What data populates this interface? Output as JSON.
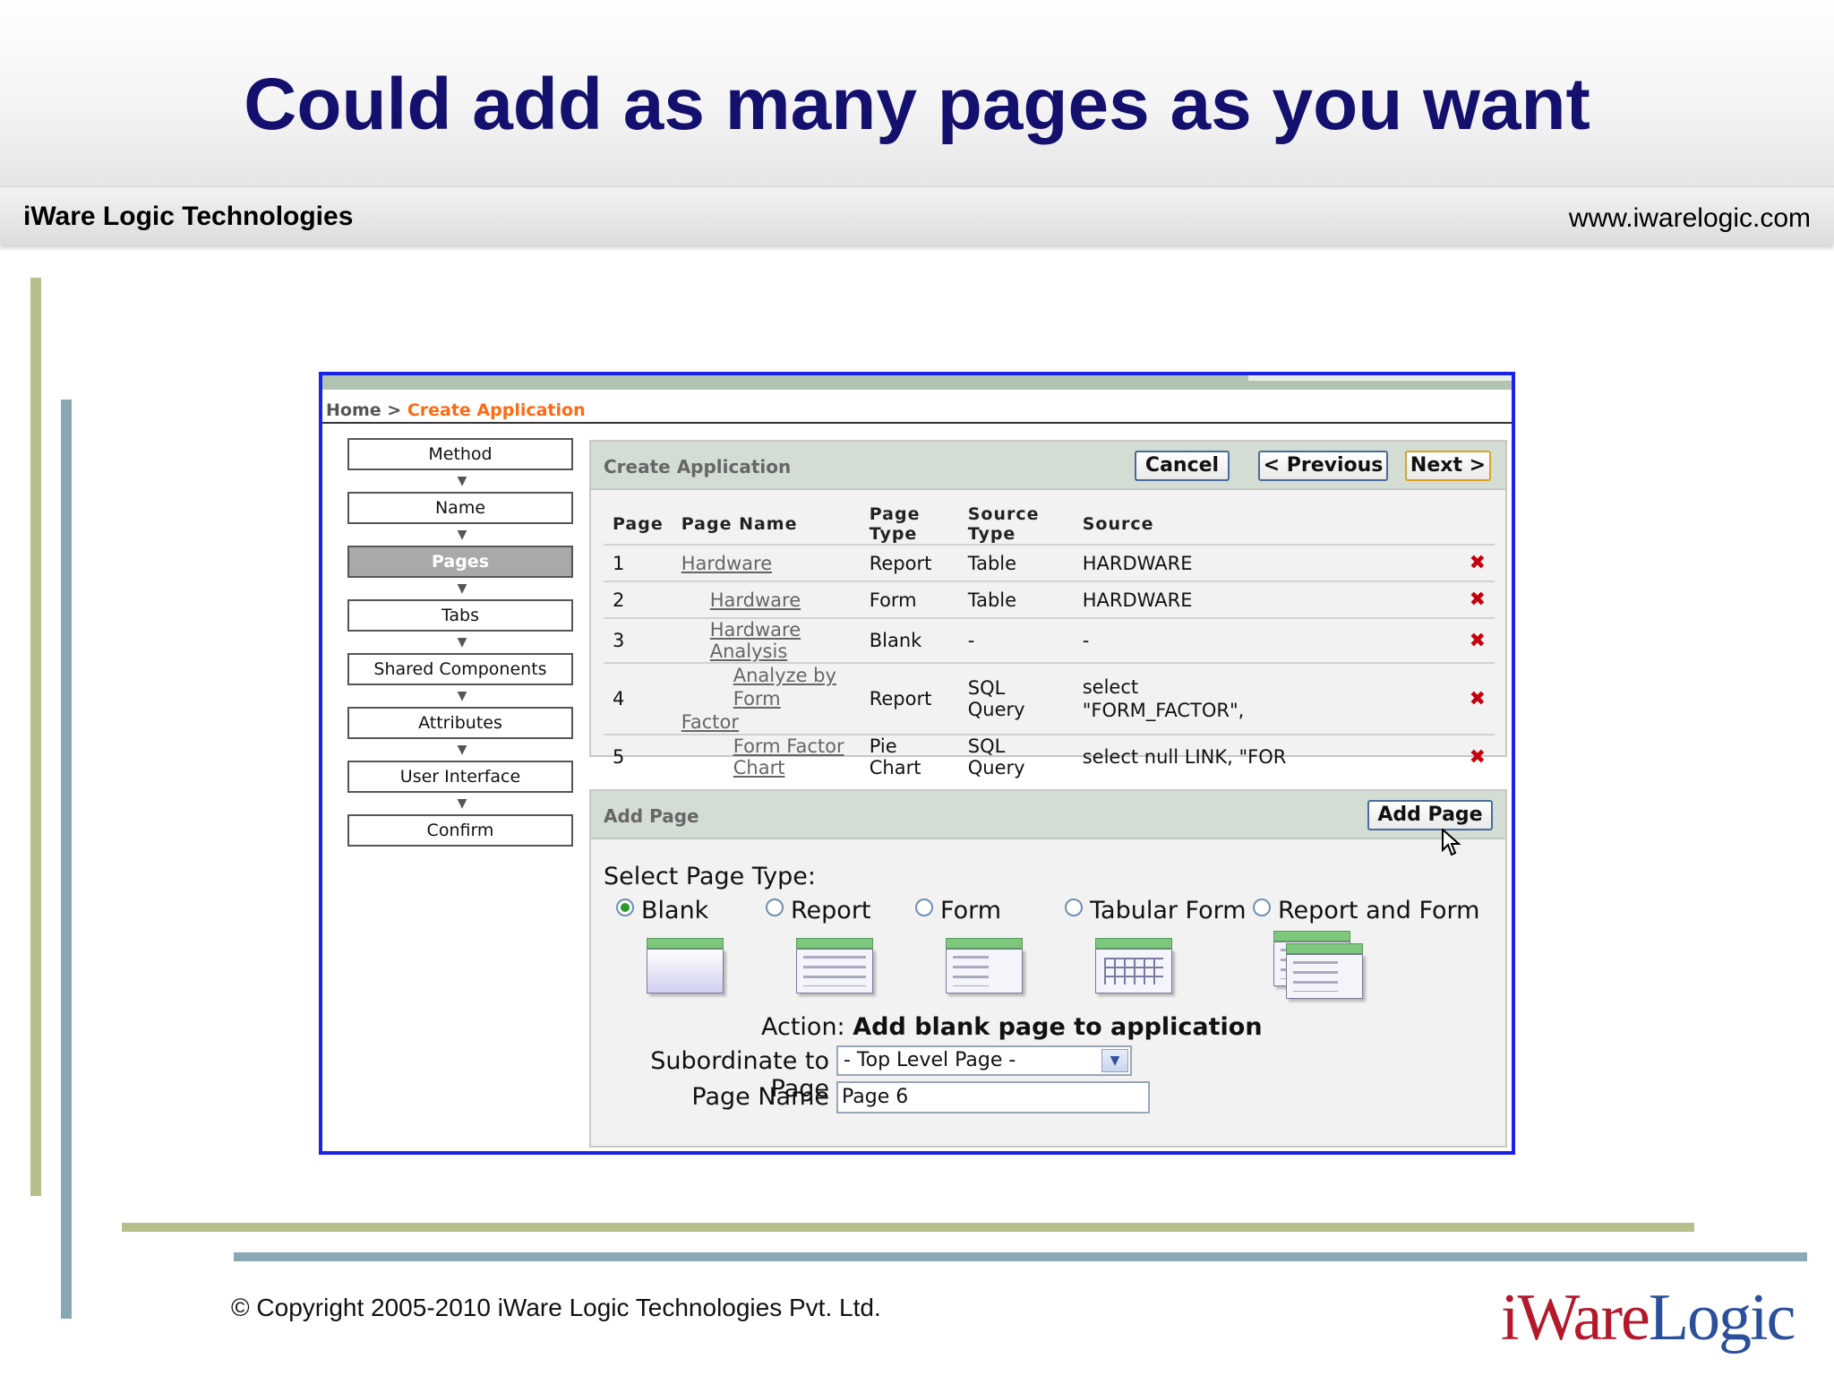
{
  "slide": {
    "title": "Could add as many pages as you want",
    "company": "iWare Logic Technologies",
    "url": "www.iwarelogic.com",
    "copyright": "© Copyright 2005-2010 iWare Logic Technologies Pvt. Ltd.",
    "logo_left": "iWare",
    "logo_right": "Logic"
  },
  "app": {
    "breadcrumb_home": "Home",
    "breadcrumb_sep": ">",
    "breadcrumb_current": "Create Application",
    "steps": [
      "Method",
      "Name",
      "Pages",
      "Tabs",
      "Shared Components",
      "Attributes",
      "User Interface",
      "Confirm"
    ],
    "active_step": "Pages",
    "create_panel": {
      "title": "Create Application",
      "cancel": "Cancel",
      "previous": "< Previous",
      "next": "Next >"
    },
    "table": {
      "headers": [
        "Page",
        "Page Name",
        "Page Type",
        "Source Type",
        "Source"
      ],
      "rows": [
        {
          "page": "1",
          "name": "Hardware",
          "type": "Report",
          "source_type": "Table",
          "source": "HARDWARE"
        },
        {
          "page": "2",
          "name": "Hardware",
          "type": "Form",
          "source_type": "Table",
          "source": "HARDWARE"
        },
        {
          "page": "3",
          "name": "Hardware Analysis",
          "type": "Blank",
          "source_type": "-",
          "source": "-"
        },
        {
          "page": "4",
          "name_line1": "Analyze by Form",
          "name_line2": "Factor",
          "type": "Report",
          "source_type": "SQL Query",
          "source_line1": "select",
          "source_line2": "\"FORM_FACTOR\","
        },
        {
          "page": "5",
          "name": "Form Factor Chart",
          "type": "Pie Chart",
          "source_type": "SQL Query",
          "source": "select null LINK, \"FOR"
        }
      ],
      "delete_glyph": "✖"
    },
    "add_panel": {
      "title": "Add Page",
      "add_button": "Add Page",
      "select_type_label": "Select Page Type:",
      "types": [
        "Blank",
        "Report",
        "Form",
        "Tabular Form",
        "Report and Form"
      ],
      "selected_type": "Blank",
      "action_label": "Action:",
      "action_value": "Add blank page to application",
      "subordinate_label": "Subordinate to Page",
      "subordinate_value": "- Top Level Page -",
      "page_name_label": "Page Name",
      "page_name_value": "Page 6"
    }
  },
  "colors": {
    "title": "#14106e",
    "frame": "#1a22e6",
    "breadcrumb_current": "#ff6a13",
    "delete": "#c4000d",
    "olive_bar": "#b6bf8c",
    "blue_bar": "#88a8b4"
  },
  "icons": [
    "chevron-down-icon",
    "delete-icon",
    "radio-icon",
    "select-arrow-icon",
    "mouse-pointer-icon"
  ]
}
